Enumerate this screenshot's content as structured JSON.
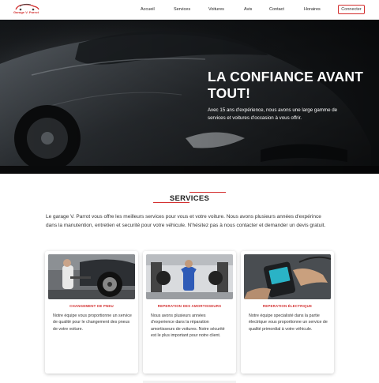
{
  "nav": {
    "logo_text": "Garage V. Parrot",
    "links": [
      "Accueil",
      "Services",
      "Voitures",
      "Avis",
      "Contact",
      "Horaires"
    ],
    "connect_label": "Connecter"
  },
  "hero": {
    "title": "LA CONFIANCE AVANT TOUT!",
    "subtitle": "Avec 15 ans d'expérience, nous avons une large gamme de services et voitures d'occasion à vous offrir."
  },
  "services": {
    "title": "SERVICES",
    "intro": "Le garage V. Parrot vous offre les meilleurs services pour vous et votre voiture. Nous avons plusieurs années d'expérince dans la manutention, entretien et securité pour votre véhicule. N'hésitez pas à nous contacter et demander un devis gratuit.",
    "cards": [
      {
        "title": "CHANGEMENT DE PNEU",
        "text": "Notre équipe vous proportionne un service de qualité pour le changement des pneus de votre voiture.",
        "icon": "tire-change-photo"
      },
      {
        "title": "REPERATION DES AMORTISSEURS",
        "text": "Nous avons plusieurs années d'experience dans la réparation amortisseurs de voitures. Notre sécurité est le plus important pour notre client.",
        "icon": "mechanic-photo"
      },
      {
        "title": "REPERATION ÉLECTRIQUE",
        "text": "Notre équipe specialisté dans la partie électrique vous proportionne un service de qualité primordial à votre véhicule.",
        "icon": "diagnostic-tablet-photo"
      }
    ]
  },
  "colors": {
    "accent": "#d32f2f",
    "text": "#333333"
  }
}
